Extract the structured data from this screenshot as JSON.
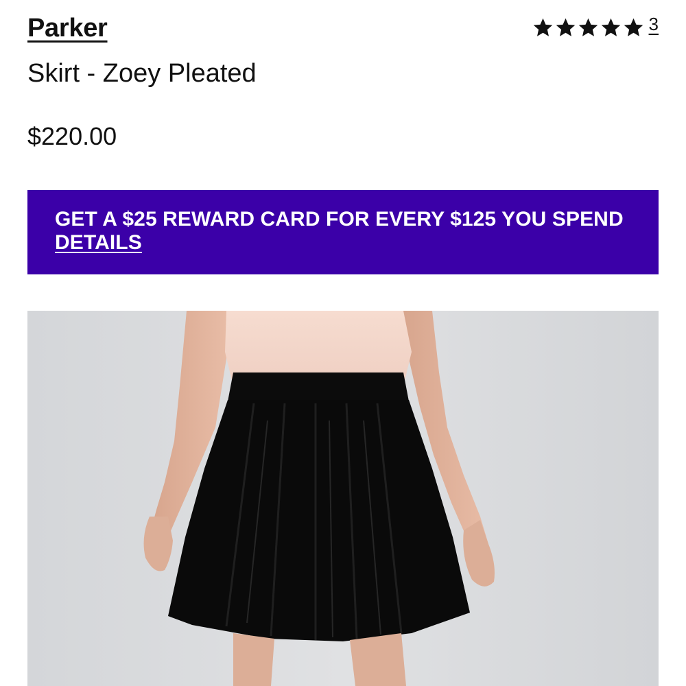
{
  "product": {
    "brand": "Parker",
    "name": "Skirt - Zoey Pleated",
    "price": "$220.00"
  },
  "rating": {
    "stars": 5,
    "count": "3",
    "star_icon": "star-icon"
  },
  "promo": {
    "text": "GET A $25 REWARD CARD FOR EVERY $125 YOU SPEND ",
    "link_label": "DETAILS",
    "background_color": "#3b00a8"
  },
  "image": {
    "alt": "product-photo"
  }
}
